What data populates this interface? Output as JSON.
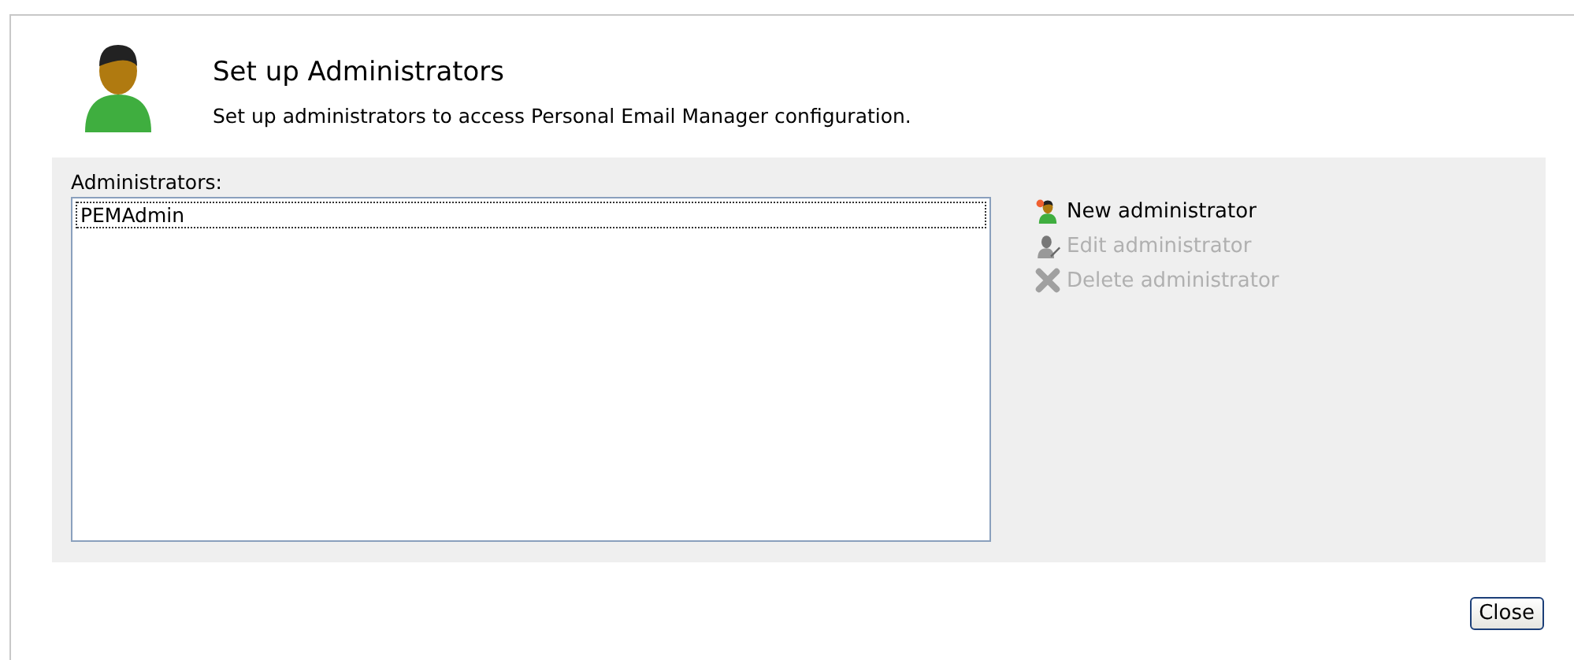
{
  "header": {
    "title": "Set up Administrators",
    "description": "Set up administrators to access Personal Email Manager configuration."
  },
  "administrators": {
    "label": "Administrators:",
    "items": [
      {
        "name": "PEMAdmin",
        "selected": true
      }
    ]
  },
  "actions": [
    {
      "kind": "new",
      "label": "New administrator",
      "disabled": false
    },
    {
      "kind": "edit",
      "label": "Edit administrator",
      "disabled": true
    },
    {
      "kind": "delete",
      "label": "Delete administrator",
      "disabled": true
    }
  ],
  "buttons": [
    "Close"
  ]
}
